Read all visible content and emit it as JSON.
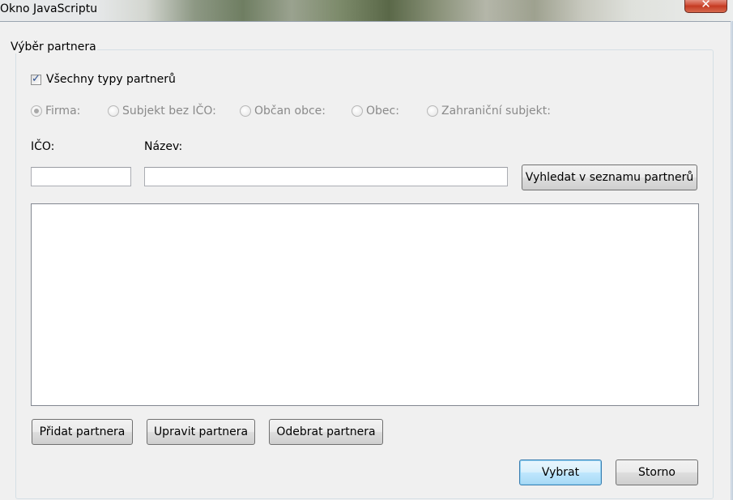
{
  "window": {
    "title": "Okno JavaScriptu",
    "close_glyph": "✕"
  },
  "group": {
    "label": "Výběr partnera"
  },
  "all_types": {
    "label": "Všechny typy partnerů",
    "checked": true
  },
  "partner_types": [
    {
      "label": "Firma:",
      "selected": true
    },
    {
      "label": "Subjekt bez IČO:",
      "selected": false
    },
    {
      "label": "Občan obce:",
      "selected": false
    },
    {
      "label": "Obec:",
      "selected": false
    },
    {
      "label": "Zahraniční subjekt:",
      "selected": false
    }
  ],
  "search": {
    "ico_label": "IČO:",
    "ico_value": "",
    "name_label": "Název:",
    "name_value": "",
    "search_button": "Vyhledat v seznamu partnerů"
  },
  "results": {
    "items": []
  },
  "actions": {
    "add": "Přidat partnera",
    "edit": "Upravit partnera",
    "remove": "Odebrat partnera"
  },
  "footer": {
    "select": "Vybrat",
    "cancel": "Storno"
  }
}
